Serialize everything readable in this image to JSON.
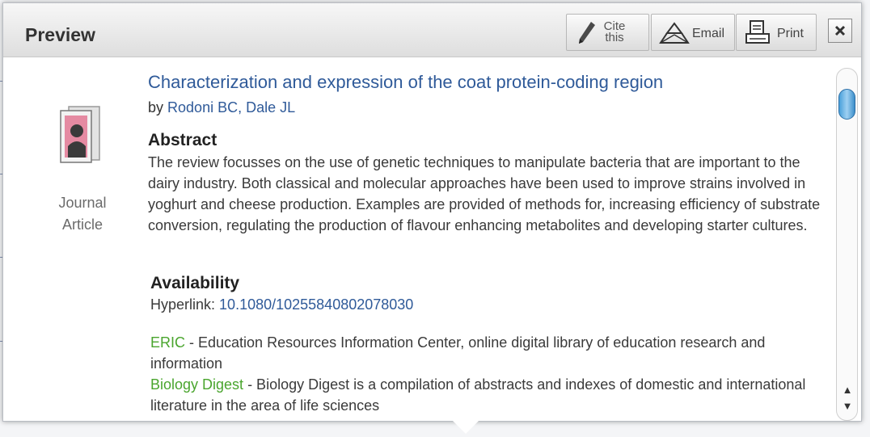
{
  "popup": {
    "title": "Preview",
    "toolbar": {
      "cite_label": "Cite this",
      "email_label": "Email",
      "print_label": "Print"
    }
  },
  "record": {
    "type_label": "Journal Article",
    "title": "Characterization and expression of the coat protein-coding region",
    "by_prefix": "by",
    "authors": "Rodoni BC, Dale JL",
    "abstract_heading": "Abstract",
    "abstract": "The review focusses on the use of genetic techniques to manipulate bacteria that are important to the dairy industry. Both classical and molecular approaches have been used to improve strains involved in yoghurt and cheese production. Examples are provided of methods for, increasing efficiency of substrate conversion, regulating the production of flavour enhancing metabolites and developing starter cultures.",
    "availability_heading": "Availability",
    "hyperlink_label": "Hyperlink:",
    "doi": "10.1080/10255840802078030"
  },
  "databases": [
    {
      "name": "ERIC",
      "description": " - Education Resources Information Center, online digital library of education research and information"
    },
    {
      "name": "Biology Digest",
      "description": " - Biology Digest is a compilation of abstracts and indexes of domestic and international literature in the area of life sciences"
    }
  ],
  "icons": {
    "cite": "pencil-icon",
    "email": "email-triangle-icon",
    "print": "printer-icon",
    "close": "close-x-icon",
    "record_type": "journal-article-icon"
  },
  "colors": {
    "link_blue": "#2f5a99",
    "database_green": "#4aa52e",
    "scroll_thumb": "#4aa0da"
  }
}
